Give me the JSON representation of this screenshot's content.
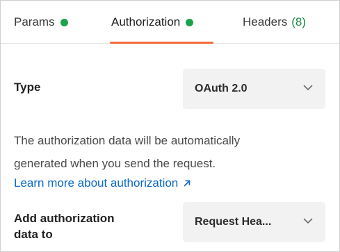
{
  "tabs": [
    {
      "label": "Params",
      "dot": true
    },
    {
      "label": "Authorization",
      "dot": true
    },
    {
      "label": "Headers",
      "count": "(8)"
    }
  ],
  "colors": {
    "dot": "#1aa34a",
    "underline": "#f26b3a",
    "count": "#1a8a3e",
    "link": "#0b68c7"
  },
  "type_row": {
    "label": "Type",
    "value": "OAuth 2.0"
  },
  "description": {
    "line1": "The authorization data will be automatically",
    "line2": "generated when you send the request.",
    "link": "Learn more about authorization"
  },
  "add_row": {
    "label_line1": "Add authorization",
    "label_line2": "data to",
    "value": "Request Hea..."
  },
  "icons": {
    "select_chevron": "chevron-down-icon",
    "external_link": "arrow-up-right-icon"
  }
}
